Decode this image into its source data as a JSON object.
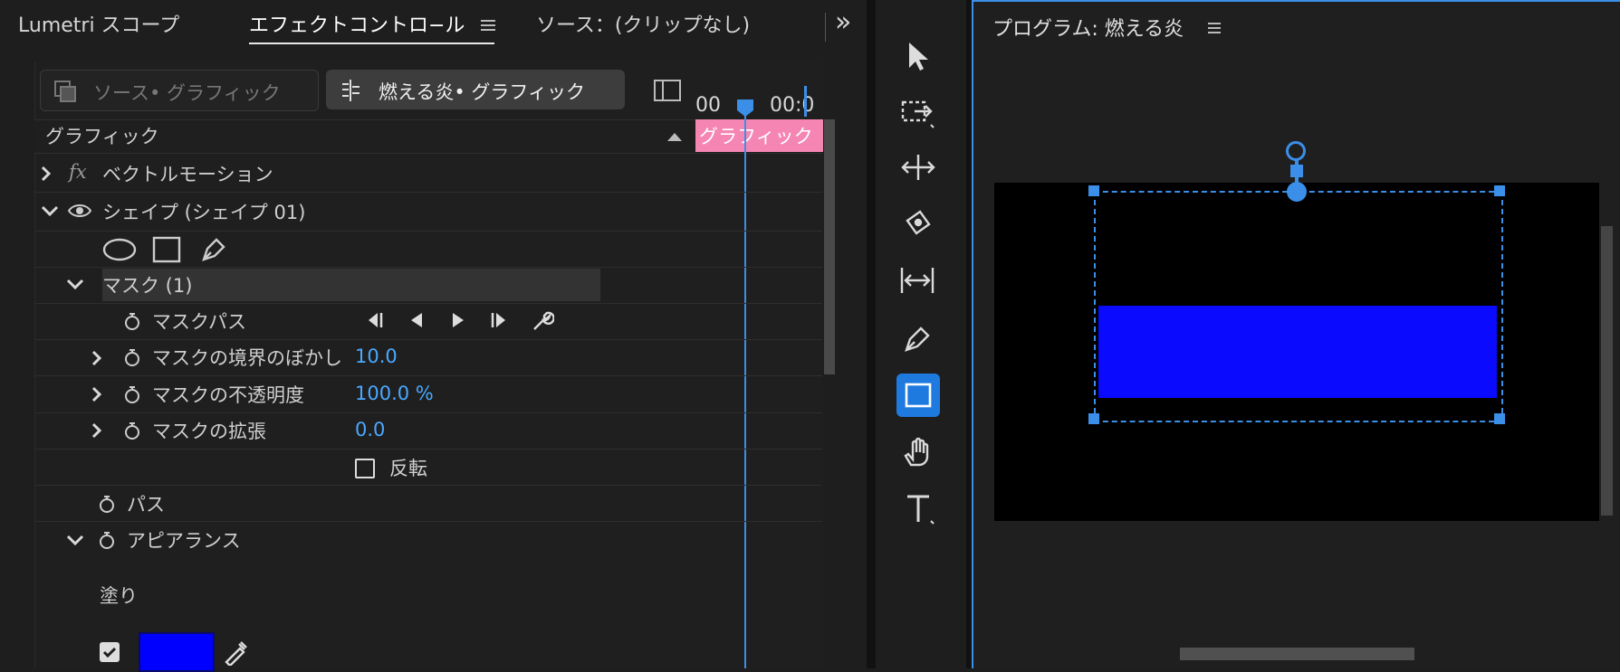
{
  "tabs": {
    "lumetri": "Lumetri スコープ",
    "effect": "エフェクトコントロ−ル",
    "source": "ソース：(クリップなし)",
    "more": "»",
    "program": "プログラム: 燃える炎"
  },
  "effect_panel": {
    "source_graphic_btn": "ソース• グラフィック",
    "active_graphic_btn": "燃える炎• グラフィック",
    "section_header": "グラフィック",
    "timeline_time_left": "00",
    "timeline_time_right": "00:0",
    "clip_label": "グラフィック",
    "vector_motion_label": "ベクトルモーション",
    "fx_glyph": "fx",
    "shape_label": "シェイプ (シェイプ 01)",
    "mask_label": "マスク (1)",
    "mask_path_label": "マスクパス",
    "feather_label": "マスクの境界のぼかし",
    "feather_value": "10.0",
    "opacity_label": "マスクの不透明度",
    "opacity_value": "100.0 %",
    "expansion_label": "マスクの拡張",
    "expansion_value": "0.0",
    "invert_label": "反転",
    "path_label": "パス",
    "appearance_label": "アピアランス",
    "fill_label": "塗り",
    "fill_color": "#0000ff"
  },
  "colors": {
    "accent": "#3b8fe8",
    "clip_pink": "#f585b3",
    "selected_tool": "#1f7ae0",
    "mask_blue": "#0a0aff"
  }
}
